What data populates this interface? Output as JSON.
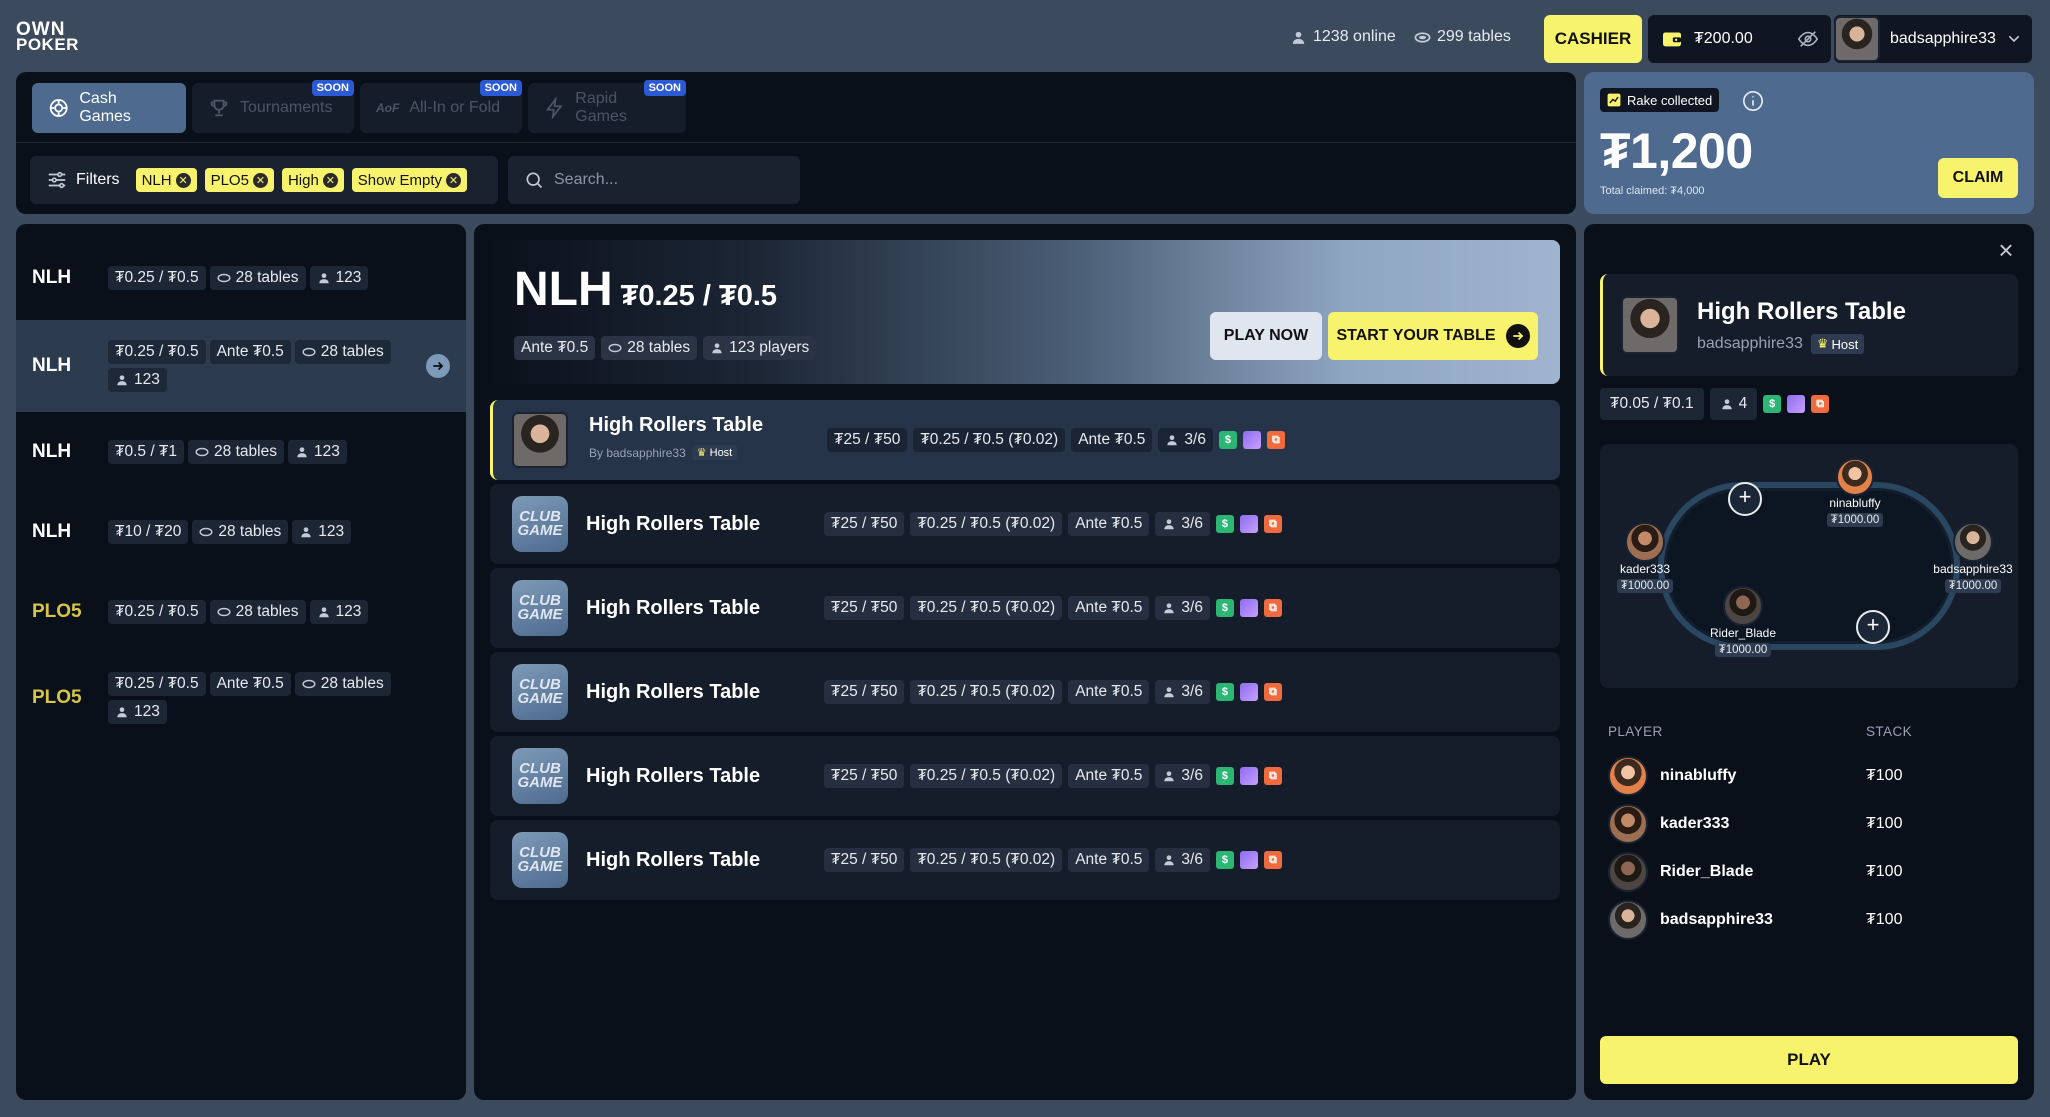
{
  "brand": {
    "line1": "OWN",
    "line2": "POKER"
  },
  "header": {
    "online": "1238 online",
    "tables": "299 tables",
    "cashier_label": "CASHIER",
    "balance": "₮200.00",
    "username": "badsapphire33"
  },
  "tabs": [
    {
      "label": "Cash Games",
      "active": true,
      "badge": ""
    },
    {
      "label": "Tournaments",
      "active": false,
      "badge": "SOON"
    },
    {
      "label": "All-In or Fold",
      "active": false,
      "badge": "SOON",
      "icon_text": "AoF"
    },
    {
      "label": "Rapid Games",
      "active": false,
      "badge": "SOON"
    }
  ],
  "filters": {
    "label": "Filters",
    "chips": [
      "NLH",
      "PLO5",
      "High",
      "Show Empty"
    ],
    "search_placeholder": "Search..."
  },
  "rake": {
    "badge": "Rake collected",
    "amount": "₮1,200",
    "total_claimed": "Total claimed: ₮4,000",
    "claim_label": "CLAIM"
  },
  "games": [
    {
      "type": "NLH",
      "stakes": "₮0.25 / ₮0.5",
      "ante": "",
      "tables": "28 tables",
      "players": "123"
    },
    {
      "type": "NLH",
      "stakes": "₮0.25 / ₮0.5",
      "ante": "Ante ₮0.5",
      "tables": "28 tables",
      "players": "123",
      "selected": true
    },
    {
      "type": "NLH",
      "stakes": "₮0.5 / ₮1",
      "ante": "",
      "tables": "28 tables",
      "players": "123"
    },
    {
      "type": "NLH",
      "stakes": "₮10 / ₮20",
      "ante": "",
      "tables": "28 tables",
      "players": "123"
    },
    {
      "type": "PLO5",
      "stakes": "₮0.25 / ₮0.5",
      "ante": "",
      "tables": "28 tables",
      "players": "123"
    },
    {
      "type": "PLO5",
      "stakes": "₮0.25 / ₮0.5",
      "ante": "Ante ₮0.5",
      "tables": "28 tables",
      "players": "123"
    }
  ],
  "hero": {
    "game": "NLH",
    "stakes": "₮0.25 / ₮0.5",
    "ante": "Ante ₮0.5",
    "tables": "28 tables",
    "players": "123 players",
    "play_now": "PLAY NOW",
    "start_table": "START YOUR TABLE"
  },
  "table_rows": [
    {
      "name": "High Rollers Table",
      "by": "By badsapphire33",
      "host": "Host",
      "buyin": "₮25 / ₮50",
      "blinds": "₮0.25 / ₮0.5 (₮0.02)",
      "ante": "Ante ₮0.5",
      "seats": "3/6",
      "selected": true,
      "club": false
    },
    {
      "name": "High Rollers Table",
      "buyin": "₮25 / ₮50",
      "blinds": "₮0.25 / ₮0.5 (₮0.02)",
      "ante": "Ante ₮0.5",
      "seats": "3/6",
      "club": true
    },
    {
      "name": "High Rollers Table",
      "buyin": "₮25 / ₮50",
      "blinds": "₮0.25 / ₮0.5 (₮0.02)",
      "ante": "Ante ₮0.5",
      "seats": "3/6",
      "club": true
    },
    {
      "name": "High Rollers Table",
      "buyin": "₮25 / ₮50",
      "blinds": "₮0.25 / ₮0.5 (₮0.02)",
      "ante": "Ante ₮0.5",
      "seats": "3/6",
      "club": true
    },
    {
      "name": "High Rollers Table",
      "buyin": "₮25 / ₮50",
      "blinds": "₮0.25 / ₮0.5 (₮0.02)",
      "ante": "Ante ₮0.5",
      "seats": "3/6",
      "club": true
    },
    {
      "name": "High Rollers Table",
      "buyin": "₮25 / ₮50",
      "blinds": "₮0.25 / ₮0.5 (₮0.02)",
      "ante": "Ante ₮0.5",
      "seats": "3/6",
      "club": true
    }
  ],
  "club_label": {
    "line1": "CLUB",
    "line2": "GAME"
  },
  "detail": {
    "title": "High Rollers Table",
    "host_name": "badsapphire33",
    "host_tag": "Host",
    "stakes": "₮0.05 / ₮0.1",
    "players": "4",
    "seats": [
      {
        "name": "ninabluffy",
        "stack": "₮1000.00"
      },
      {
        "name": "kader333",
        "stack": "₮1000.00"
      },
      {
        "name": "badsapphire33",
        "stack": "₮1000.00"
      },
      {
        "name": "Rider_Blade",
        "stack": "₮1000.00"
      }
    ],
    "col_player": "PLAYER",
    "col_stack": "STACK",
    "player_list": [
      {
        "name": "ninabluffy",
        "stack": "₮100"
      },
      {
        "name": "kader333",
        "stack": "₮100"
      },
      {
        "name": "Rider_Blade",
        "stack": "₮100"
      },
      {
        "name": "badsapphire33",
        "stack": "₮100"
      }
    ],
    "play_label": "PLAY"
  },
  "colors": {
    "accent": "#f8f36c",
    "active_tab": "#4e6b8f",
    "background": "#3c4a5e",
    "panel": "#0a101a"
  }
}
